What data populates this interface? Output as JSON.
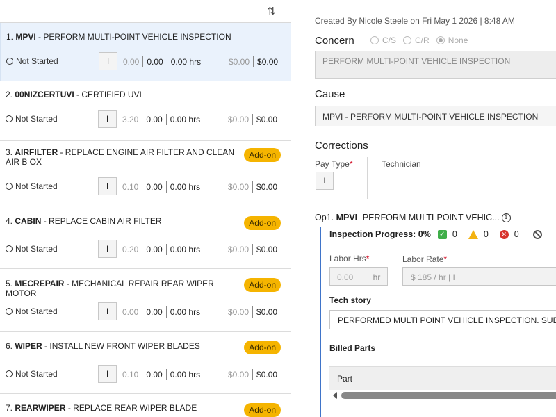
{
  "sort_icon": "sort-up-down-icon",
  "operations": [
    {
      "code": "MPVI",
      "num": "1.",
      "desc": " - PERFORM MULTI-POINT VEHICLE INSPECTION",
      "addon": "",
      "status": "Not Started",
      "pay": "I",
      "sold": "0.00",
      "hrs1": "0.00",
      "hrs2": "0.00 hrs",
      "price1": "$0.00",
      "price2": "$0.00"
    },
    {
      "code": "00NIZCERTUVI",
      "num": "2.",
      "desc": " - CERTIFIED UVI",
      "addon": "",
      "status": "Not Started",
      "pay": "I",
      "sold": "3.20",
      "hrs1": "0.00",
      "hrs2": "0.00 hrs",
      "price1": "$0.00",
      "price2": "$0.00"
    },
    {
      "code": "AIRFILTER",
      "num": "3.",
      "desc": " - REPLACE ENGINE AIR FILTER AND CLEAN AIR B OX",
      "addon": "Add-on",
      "status": "Not Started",
      "pay": "I",
      "sold": "0.10",
      "hrs1": "0.00",
      "hrs2": "0.00 hrs",
      "price1": "$0.00",
      "price2": "$0.00"
    },
    {
      "code": "CABIN",
      "num": "4.",
      "desc": " - REPLACE CABIN AIR FILTER",
      "addon": "Add-on",
      "status": "Not Started",
      "pay": "I",
      "sold": "0.20",
      "hrs1": "0.00",
      "hrs2": "0.00 hrs",
      "price1": "$0.00",
      "price2": "$0.00"
    },
    {
      "code": "MECREPAIR",
      "num": "5.",
      "desc": " - MECHANICAL REPAIR REAR WIPER MOTOR",
      "addon": "Add-on",
      "status": "Not Started",
      "pay": "I",
      "sold": "0.00",
      "hrs1": "0.00",
      "hrs2": "0.00 hrs",
      "price1": "$0.00",
      "price2": "$0.00"
    },
    {
      "code": "WIPER",
      "num": "6.",
      "desc": " - INSTALL NEW FRONT WIPER BLADES",
      "addon": "Add-on",
      "status": "Not Started",
      "pay": "I",
      "sold": "0.10",
      "hrs1": "0.00",
      "hrs2": "0.00 hrs",
      "price1": "$0.00",
      "price2": "$0.00"
    },
    {
      "code": "REARWIPER",
      "num": "7.",
      "desc": " - REPLACE REAR WIPER BLADE",
      "addon": "Add-on",
      "status": "",
      "pay": "",
      "sold": "",
      "hrs1": "",
      "hrs2": "",
      "price1": "",
      "price2": ""
    }
  ],
  "detail": {
    "created": "Created By Nicole Steele on Fri May 1 2026 | 8:48 AM",
    "concern_label": "Concern",
    "concern_options": [
      "C/S",
      "C/R",
      "None"
    ],
    "concern_selected": "None",
    "concern_text": "PERFORM MULTI-POINT VEHICLE INSPECTION",
    "cause_label": "Cause",
    "cause_text": "MPVI - PERFORM MULTI-POINT VEHICLE INSPECTION",
    "corrections_label": "Corrections",
    "pay_type_label": "Pay Type",
    "required_mark": "*",
    "pay_type_value": "I",
    "technician_label": "Technician",
    "op_prefix": "Op1.",
    "op_code": "MPVI",
    "op_desc": " - PERFORM MULTI-POINT VEHIC...",
    "info_icon": "info-icon",
    "inspection_label": "Inspection Progress: 0%",
    "count_ok": "0",
    "count_warn": "0",
    "count_bad": "0",
    "labor_hrs_label": "Labor Hrs",
    "labor_hrs_value": "0.00",
    "labor_hrs_unit": "hr",
    "labor_rate_label": "Labor Rate",
    "labor_rate_value": "$ 185 / hr | I",
    "tech_story_label": "Tech story",
    "tech_story_value": "PERFORMED MULTI POINT VEHICLE INSPECTION. SUBMITTED",
    "billed_parts_label": "Billed Parts",
    "parts_column": "Part"
  }
}
